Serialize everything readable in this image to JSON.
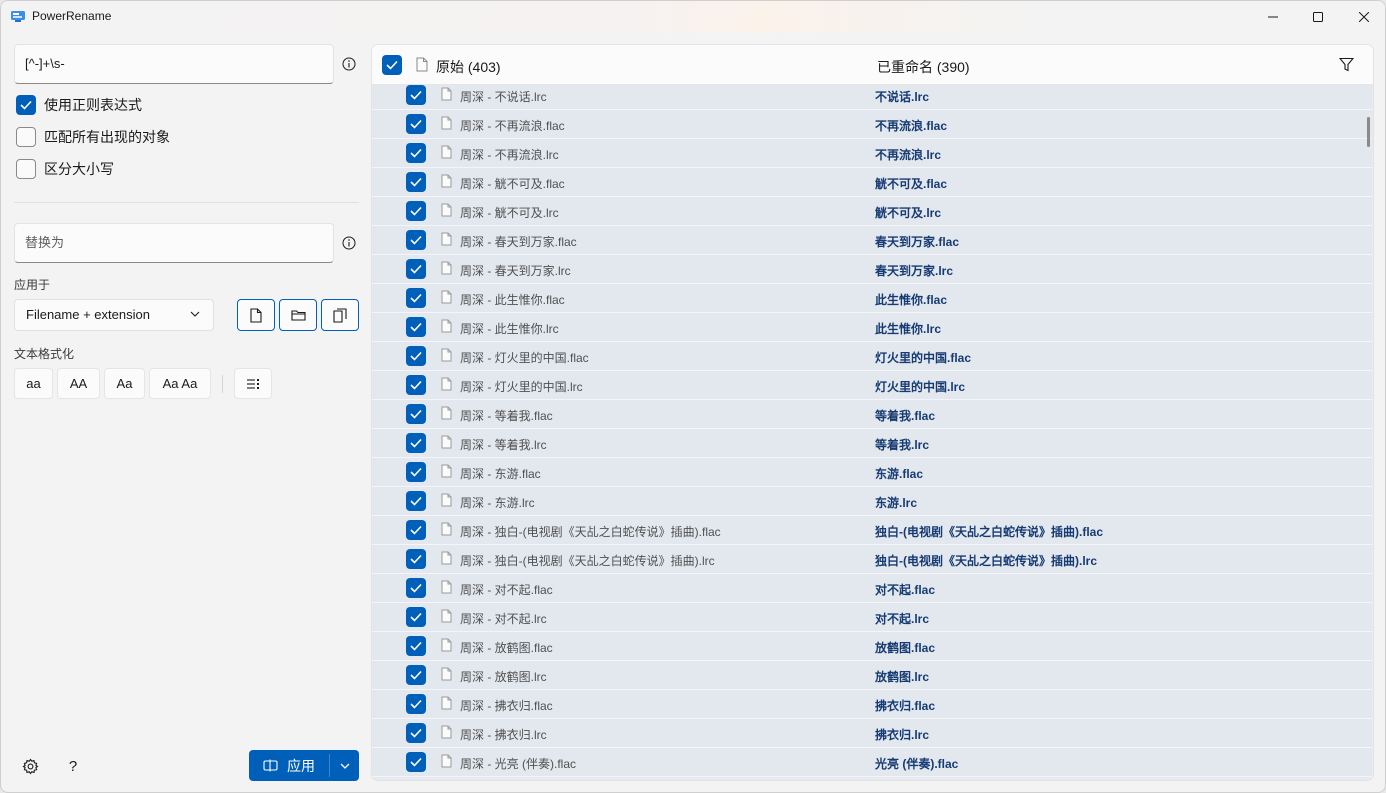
{
  "window": {
    "title": "PowerRename"
  },
  "search": {
    "value": "[^-]+\\s-"
  },
  "options": {
    "regex": {
      "label": "使用正则表达式",
      "checked": true
    },
    "match_all": {
      "label": "匹配所有出现的对象",
      "checked": false
    },
    "case_sensitive": {
      "label": "区分大小写",
      "checked": false
    }
  },
  "replace": {
    "placeholder": "替换为"
  },
  "apply_to": {
    "label": "应用于",
    "selected": "Filename + extension"
  },
  "text_format": {
    "label": "文本格式化",
    "buttons": [
      "aa",
      "AA",
      "Aa",
      "Aa Aa"
    ]
  },
  "apply_button": {
    "label": "应用"
  },
  "list_header": {
    "original": "原始 (403)",
    "renamed": "已重命名 (390)"
  },
  "accent_color": "#005fb8",
  "rows": [
    {
      "original": "周深 - 不说话.lrc",
      "renamed": "不说话.lrc"
    },
    {
      "original": "周深 - 不再流浪.flac",
      "renamed": "不再流浪.flac"
    },
    {
      "original": "周深 - 不再流浪.lrc",
      "renamed": "不再流浪.lrc"
    },
    {
      "original": "周深 - 觥不可及.flac",
      "renamed": "觥不可及.flac"
    },
    {
      "original": "周深 - 觥不可及.lrc",
      "renamed": "觥不可及.lrc"
    },
    {
      "original": "周深 - 春天到万家.flac",
      "renamed": "春天到万家.flac"
    },
    {
      "original": "周深 - 春天到万家.lrc",
      "renamed": "春天到万家.lrc"
    },
    {
      "original": "周深 - 此生惟你.flac",
      "renamed": "此生惟你.flac"
    },
    {
      "original": "周深 - 此生惟你.lrc",
      "renamed": "此生惟你.lrc"
    },
    {
      "original": "周深 - 灯火里的中国.flac",
      "renamed": "灯火里的中国.flac"
    },
    {
      "original": "周深 - 灯火里的中国.lrc",
      "renamed": "灯火里的中国.lrc"
    },
    {
      "original": "周深 - 等着我.flac",
      "renamed": "等着我.flac"
    },
    {
      "original": "周深 - 等着我.lrc",
      "renamed": "等着我.lrc"
    },
    {
      "original": "周深 - 东游.flac",
      "renamed": "东游.flac"
    },
    {
      "original": "周深 - 东游.lrc",
      "renamed": "东游.lrc"
    },
    {
      "original": "周深 - 独白-(电视剧《天乩之白蛇传说》插曲).flac",
      "renamed": "独白-(电视剧《天乩之白蛇传说》插曲).flac"
    },
    {
      "original": "周深 - 独白-(电视剧《天乩之白蛇传说》插曲).lrc",
      "renamed": "独白-(电视剧《天乩之白蛇传说》插曲).lrc"
    },
    {
      "original": "周深 - 对不起.flac",
      "renamed": "对不起.flac"
    },
    {
      "original": "周深 - 对不起.lrc",
      "renamed": "对不起.lrc"
    },
    {
      "original": "周深 - 放鹤图.flac",
      "renamed": "放鹤图.flac"
    },
    {
      "original": "周深 - 放鹤图.lrc",
      "renamed": "放鹤图.lrc"
    },
    {
      "original": "周深 - 拂衣归.flac",
      "renamed": "拂衣归.flac"
    },
    {
      "original": "周深 - 拂衣归.lrc",
      "renamed": "拂衣归.lrc"
    },
    {
      "original": "周深 - 光亮 (伴奏).flac",
      "renamed": "光亮 (伴奏).flac"
    }
  ]
}
